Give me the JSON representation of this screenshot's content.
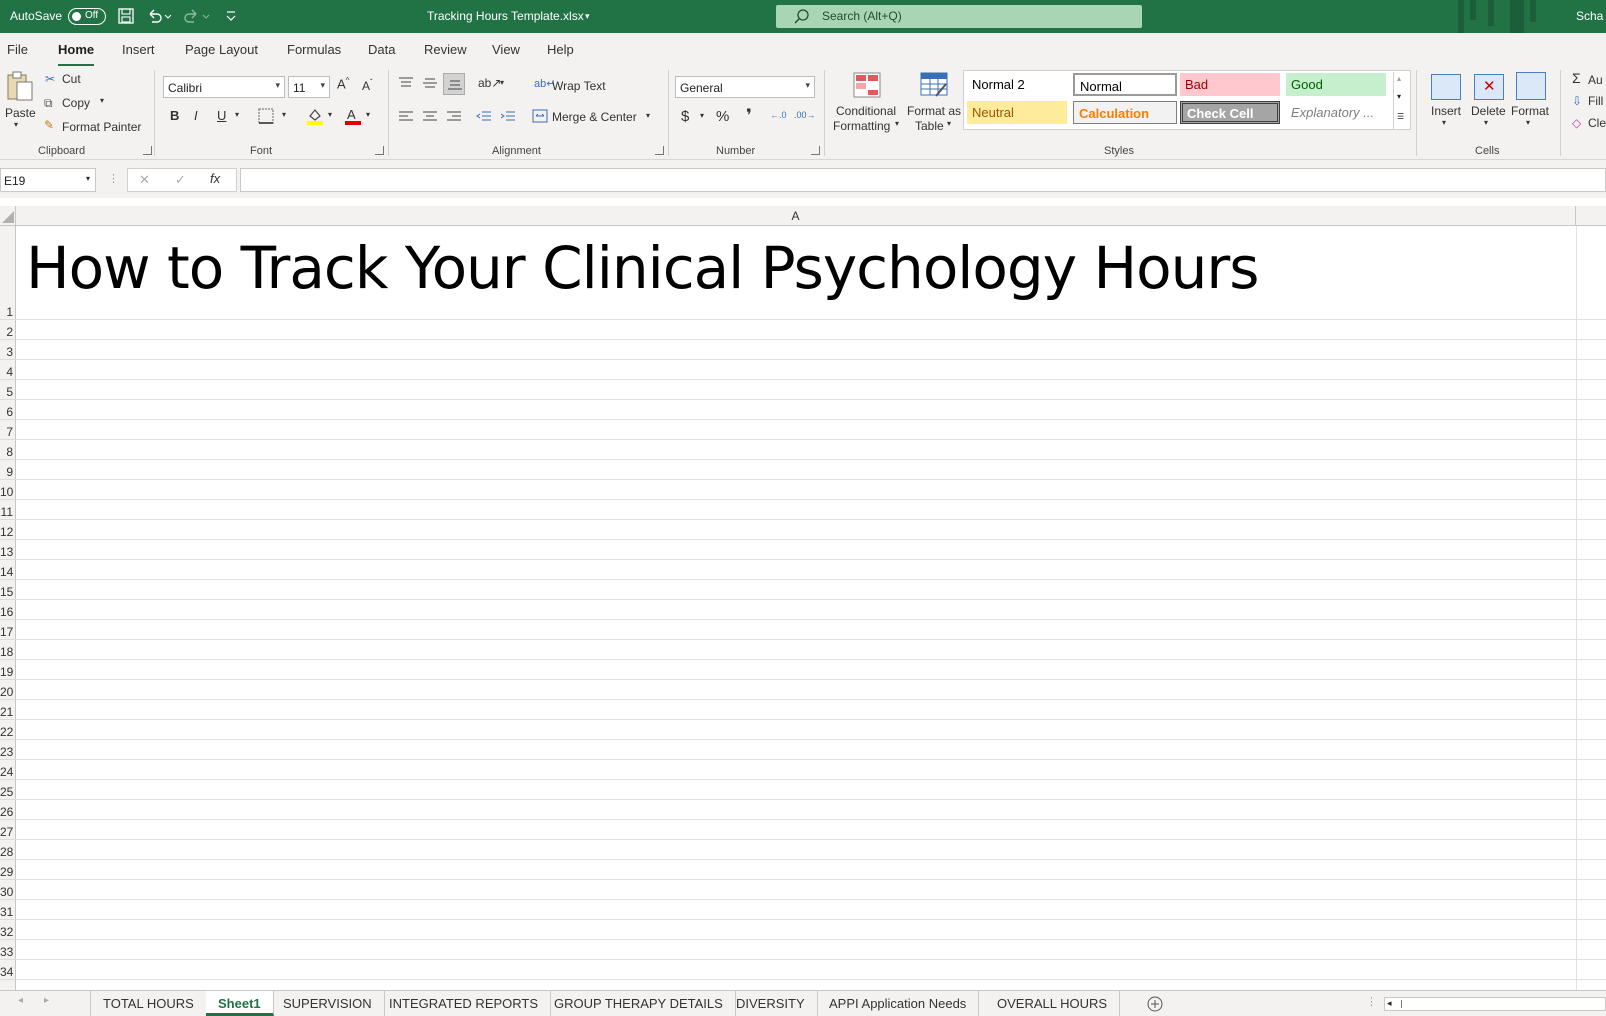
{
  "titlebar": {
    "autosave_label": "AutoSave",
    "autosave_state": "Off",
    "filename": "Tracking Hours Template.xlsx",
    "search_placeholder": "Search (Alt+Q)",
    "user": "Scha"
  },
  "menu": {
    "tabs": [
      "File",
      "Home",
      "Insert",
      "Page Layout",
      "Formulas",
      "Data",
      "Review",
      "View",
      "Help"
    ],
    "active": "Home"
  },
  "ribbon": {
    "clipboard": {
      "paste": "Paste",
      "cut": "Cut",
      "copy": "Copy",
      "format_painter": "Format Painter",
      "group": "Clipboard"
    },
    "font": {
      "name": "Calibri",
      "size": "11",
      "bold": "B",
      "italic": "I",
      "underline": "U",
      "group": "Font"
    },
    "alignment": {
      "wrap_text": "Wrap Text",
      "merge_center": "Merge & Center",
      "group": "Alignment"
    },
    "number": {
      "format": "General",
      "currency": "$",
      "percent": "%",
      "comma": "❜",
      "group": "Number"
    },
    "styles": {
      "conditional_formatting_1": "Conditional",
      "conditional_formatting_2": "Formatting",
      "format_as_table_1": "Format as",
      "format_as_table_2": "Table",
      "cells": [
        {
          "label": "Normal 2"
        },
        {
          "label": "Normal"
        },
        {
          "label": "Bad"
        },
        {
          "label": "Good"
        },
        {
          "label": "Neutral"
        },
        {
          "label": "Calculation"
        },
        {
          "label": "Check Cell"
        },
        {
          "label": "Explanatory ..."
        }
      ],
      "group": "Styles"
    },
    "cells": {
      "insert": "Insert",
      "delete": "Delete",
      "format": "Format",
      "group": "Cells"
    },
    "editing": {
      "autosum": "Au",
      "fill": "Fill",
      "clear": "Cle"
    }
  },
  "formula_bar": {
    "name_box": "E19",
    "fx": "fx",
    "value": ""
  },
  "sheet": {
    "column_header": "A",
    "rows": [
      "1",
      "2",
      "3",
      "4",
      "5",
      "6",
      "7",
      "8",
      "9",
      "10",
      "11",
      "12",
      "13",
      "14",
      "15",
      "16",
      "17",
      "18",
      "19",
      "20",
      "21",
      "22",
      "23",
      "24",
      "25",
      "26",
      "27",
      "28",
      "29",
      "30",
      "31",
      "32",
      "33",
      "34"
    ],
    "title_cell": "How to Track Your Clinical Psychology Hours"
  },
  "sheet_tabs": {
    "tabs": [
      "TOTAL HOURS",
      "Sheet1",
      "SUPERVISION",
      "INTEGRATED REPORTS",
      "GROUP THERAPY DETAILS",
      "DIVERSITY",
      "APPI Application Needs",
      "OVERALL HOURS"
    ],
    "active": "Sheet1"
  },
  "colors": {
    "accent": "#217346",
    "ribbon_bg": "#f3f2f1"
  }
}
